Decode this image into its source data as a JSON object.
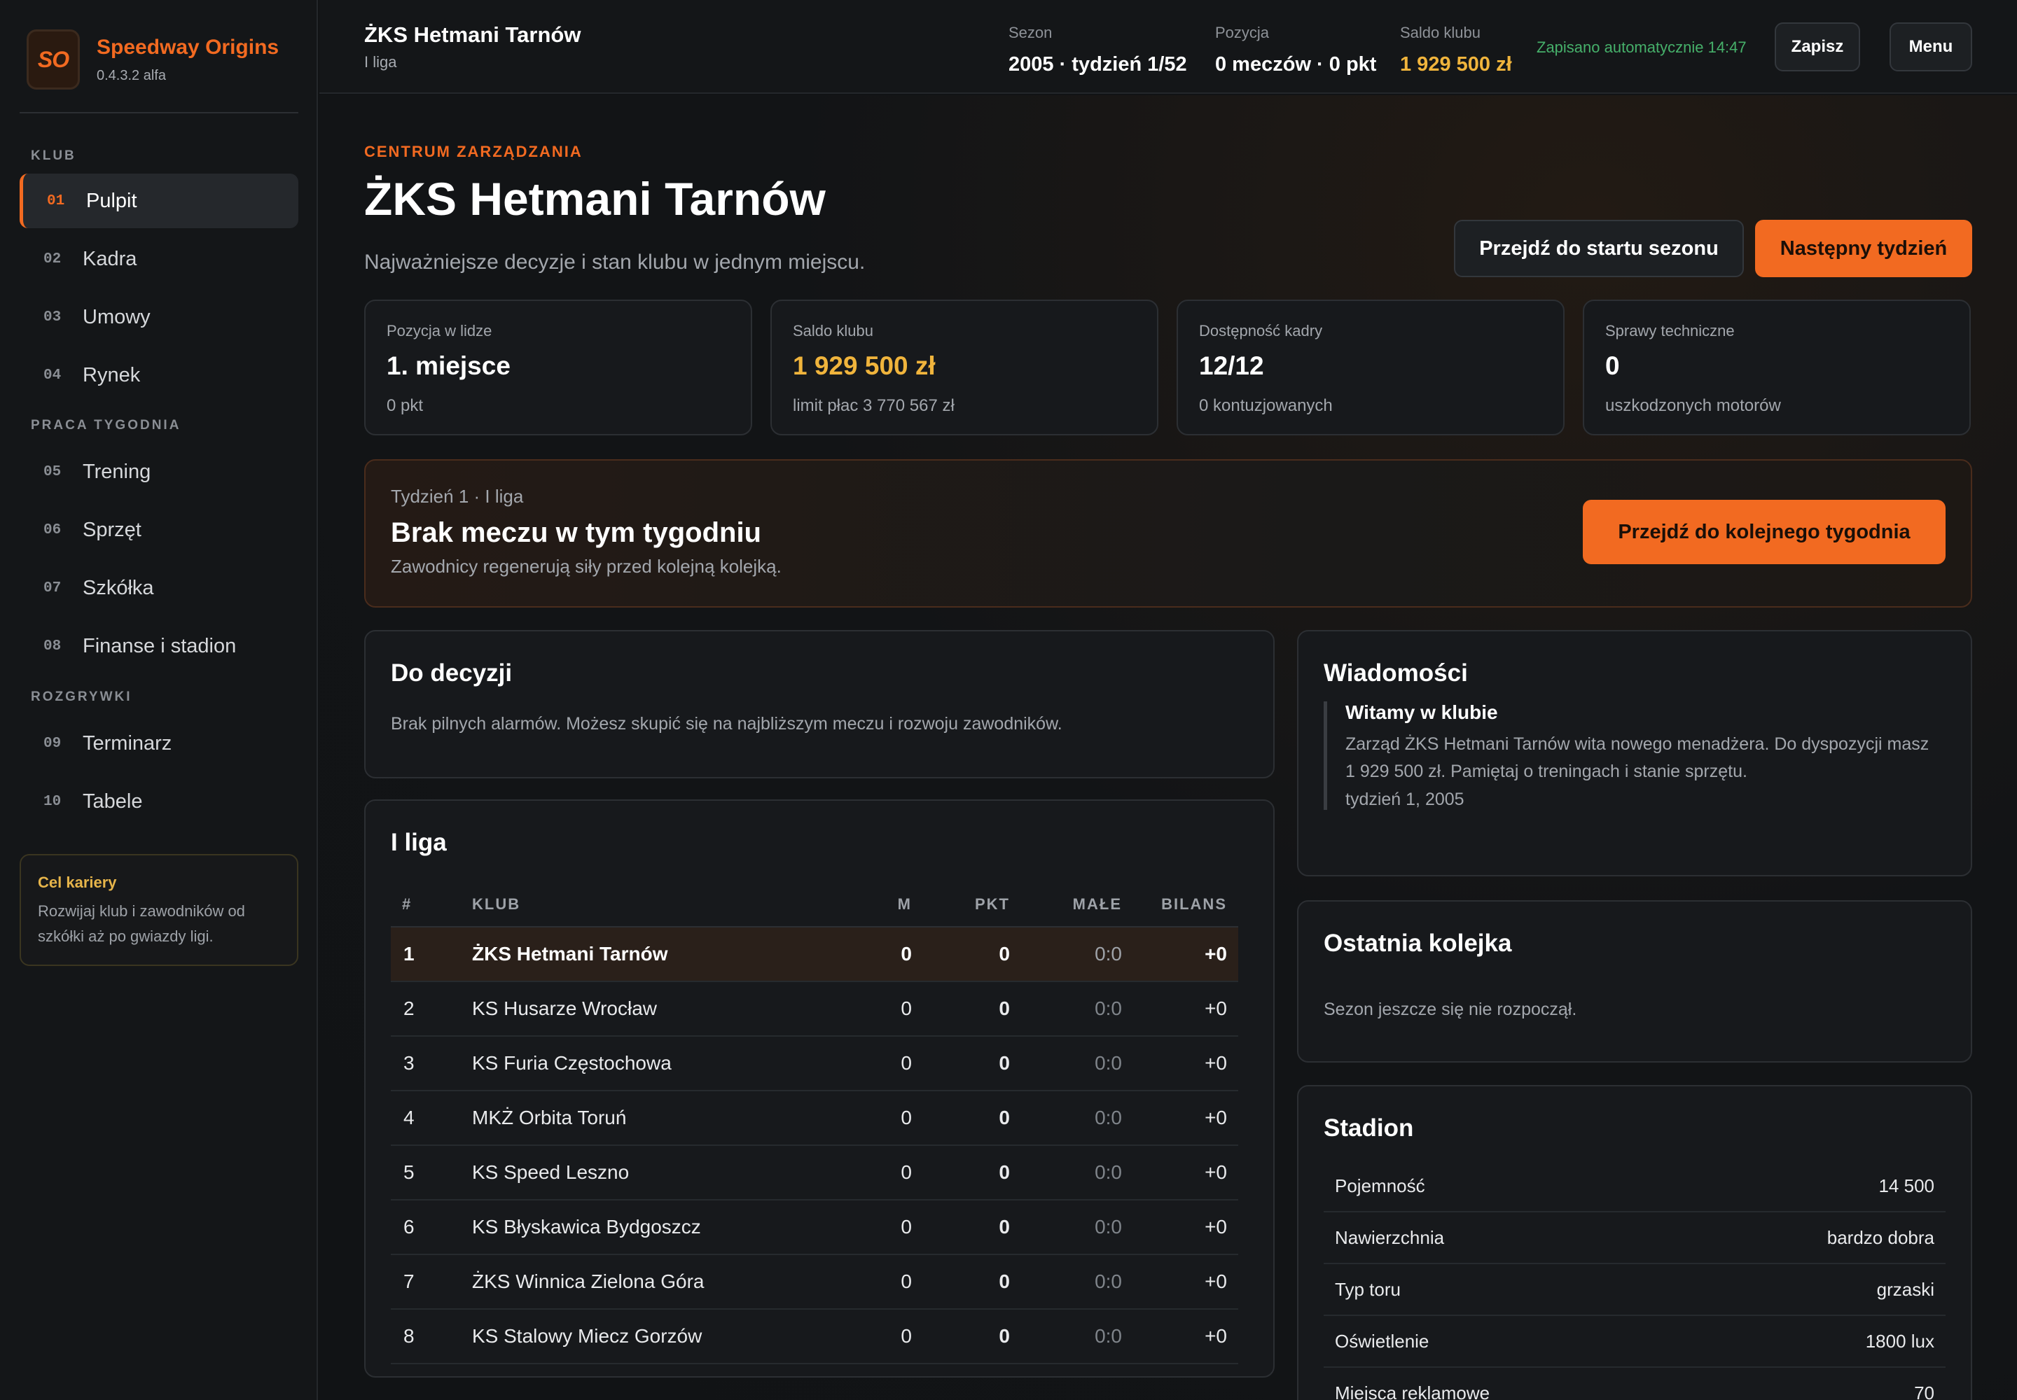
{
  "app": {
    "logo": "SO",
    "name": "Speedway Origins",
    "version": "0.4.3.2 alfa"
  },
  "sidebar": {
    "sections": [
      {
        "title": "KLUB"
      },
      {
        "title": "PRACA TYGODNIA"
      },
      {
        "title": "ROZGRYWKI"
      }
    ],
    "items": [
      {
        "num": "01",
        "label": "Pulpit",
        "active": true
      },
      {
        "num": "02",
        "label": "Kadra"
      },
      {
        "num": "03",
        "label": "Umowy"
      },
      {
        "num": "04",
        "label": "Rynek"
      },
      {
        "num": "05",
        "label": "Trening"
      },
      {
        "num": "06",
        "label": "Sprzęt"
      },
      {
        "num": "07",
        "label": "Szkółka"
      },
      {
        "num": "08",
        "label": "Finanse i stadion"
      },
      {
        "num": "09",
        "label": "Terminarz"
      },
      {
        "num": "10",
        "label": "Tabele"
      }
    ],
    "goal": {
      "title": "Cel kariery",
      "text": "Rozwijaj klub i zawodników od szkółki aż po gwiazdy ligi."
    }
  },
  "header": {
    "club": "ŻKS Hetmani Tarnów",
    "league": "I liga",
    "season": {
      "label": "Sezon",
      "value": "2005 · tydzień 1/52"
    },
    "position": {
      "label": "Pozycja",
      "value": "0 meczów · 0 pkt"
    },
    "balance": {
      "label": "Saldo klubu",
      "value": "1 929 500 zł"
    },
    "autosave": "Zapisano automatycznie 14:47",
    "save_label": "Zapisz",
    "menu_label": "Menu"
  },
  "hero": {
    "eyebrow": "CENTRUM ZARZĄDZANIA",
    "title": "ŻKS Hetmani Tarnów",
    "subtitle": "Najważniejsze decyzje i stan klubu w jednym miejscu.",
    "btn_season": "Przejdź do startu sezonu",
    "btn_next": "Następny tydzień"
  },
  "kpis": [
    {
      "label": "Pozycja w lidze",
      "value": "1. miejsce",
      "sub": "0 pkt"
    },
    {
      "label": "Saldo klubu",
      "value": "1 929 500 zł",
      "sub": "limit płac 3 770 567 zł"
    },
    {
      "label": "Dostępność kadry",
      "value": "12/12",
      "sub": "0 kontuzjowanych"
    },
    {
      "label": "Sprawy techniczne",
      "value": "0",
      "sub": "uszkodzonych motorów"
    }
  ],
  "week": {
    "kicker": "Tydzień 1 · I liga",
    "title": "Brak meczu w tym tygodniu",
    "desc": "Zawodnicy regenerują siły przed kolejną kolejką.",
    "btn": "Przejdź do kolejnego tygodnia"
  },
  "decisions": {
    "title": "Do decyzji",
    "text": "Brak pilnych alarmów. Możesz skupić się na najbliższym meczu i rozwoju zawodników."
  },
  "league": {
    "title": "I liga",
    "headers": [
      "#",
      "KLUB",
      "M",
      "PKT",
      "MAŁE",
      "BILANS"
    ],
    "rows": [
      [
        "1",
        "ŻKS Hetmani Tarnów",
        "0",
        "0",
        "0:0",
        "+0"
      ],
      [
        "2",
        "KS Husarze Wrocław",
        "0",
        "0",
        "0:0",
        "+0"
      ],
      [
        "3",
        "KS Furia Częstochowa",
        "0",
        "0",
        "0:0",
        "+0"
      ],
      [
        "4",
        "MKŻ Orbita Toruń",
        "0",
        "0",
        "0:0",
        "+0"
      ],
      [
        "5",
        "KS Speed Leszno",
        "0",
        "0",
        "0:0",
        "+0"
      ],
      [
        "6",
        "KS Błyskawica Bydgoszcz",
        "0",
        "0",
        "0:0",
        "+0"
      ],
      [
        "7",
        "ŻKS Winnica Zielona Góra",
        "0",
        "0",
        "0:0",
        "+0"
      ],
      [
        "8",
        "KS Stalowy Miecz Gorzów",
        "0",
        "0",
        "0:0",
        "+0"
      ]
    ]
  },
  "news": {
    "title": "Wiadomości",
    "item": {
      "title": "Witamy w klubie",
      "body": "Zarząd ŻKS Hetmani Tarnów wita nowego menadżera. Do dyspozycji masz 1 929 500 zł. Pamiętaj o treningach i stanie sprzętu.",
      "date": "tydzień 1, 2005"
    }
  },
  "last_round": {
    "title": "Ostatnia kolejka",
    "text": "Sezon jeszcze się nie rozpoczął."
  },
  "stadium": {
    "title": "Stadion",
    "rows": [
      {
        "label": "Pojemność",
        "value": "14 500"
      },
      {
        "label": "Nawierzchnia",
        "value": "bardzo dobra"
      },
      {
        "label": "Typ toru",
        "value": "grzaski"
      },
      {
        "label": "Oświetlenie",
        "value": "1800 lux"
      },
      {
        "label": "Miejsca reklamowe",
        "value": "70"
      }
    ]
  }
}
